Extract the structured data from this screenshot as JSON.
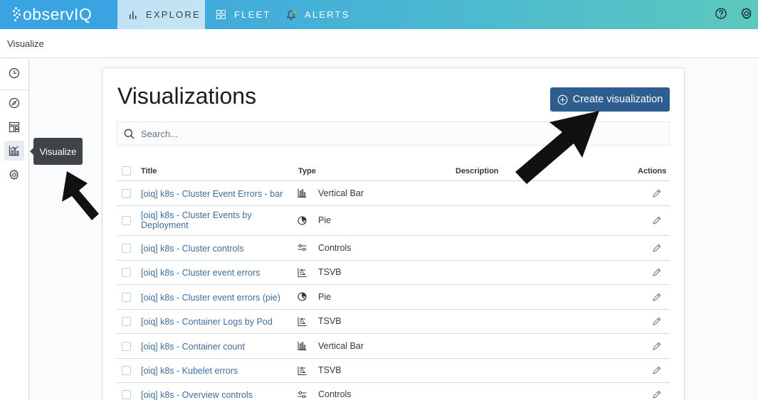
{
  "app": {
    "logo_text": "observIQ"
  },
  "topnav": {
    "tabs": [
      {
        "label": "EXPLORE",
        "icon": "bar-chart-icon",
        "active": true
      },
      {
        "label": "FLEET",
        "icon": "grid-icon",
        "active": false
      },
      {
        "label": "ALERTS",
        "icon": "bell-icon",
        "active": false
      }
    ],
    "right_icons": [
      "help-icon",
      "gear-icon"
    ]
  },
  "breadcrumb": {
    "current": "Visualize"
  },
  "sidenav": {
    "items": [
      "clock-icon",
      "compass-icon",
      "dashboard-icon",
      "visualize-icon",
      "gear-icon"
    ],
    "active": "visualize-icon",
    "tooltip": "Visualize"
  },
  "page": {
    "title": "Visualizations",
    "create_button": "Create visualization",
    "search_placeholder": "Search..."
  },
  "table": {
    "columns": {
      "title": "Title",
      "type": "Type",
      "description": "Description",
      "actions": "Actions"
    },
    "rows": [
      {
        "title": "[oiq] k8s - Cluster Event Errors - bar",
        "type": "Vertical Bar",
        "type_icon": "vertical-bar-icon"
      },
      {
        "title": "[oiq] k8s - Cluster Events by Deployment",
        "type": "Pie",
        "type_icon": "pie-icon"
      },
      {
        "title": "[oiq] k8s - Cluster controls",
        "type": "Controls",
        "type_icon": "controls-icon"
      },
      {
        "title": "[oiq] k8s - Cluster event errors",
        "type": "TSVB",
        "type_icon": "tsvb-icon"
      },
      {
        "title": "[oiq] k8s - Cluster event errors (pie)",
        "type": "Pie",
        "type_icon": "pie-icon"
      },
      {
        "title": "[oiq] k8s - Container Logs by Pod",
        "type": "TSVB",
        "type_icon": "tsvb-icon"
      },
      {
        "title": "[oiq] k8s - Container count",
        "type": "Vertical Bar",
        "type_icon": "vertical-bar-icon"
      },
      {
        "title": "[oiq] k8s - Kubelet errors",
        "type": "TSVB",
        "type_icon": "tsvb-icon"
      },
      {
        "title": "[oiq] k8s - Overview controls",
        "type": "Controls",
        "type_icon": "controls-icon"
      }
    ]
  },
  "colors": {
    "accent": "#2e5d8f",
    "link": "#3c6e9f",
    "nav_gradient_start": "#3a9ee0",
    "nav_gradient_end": "#5cc8bd"
  }
}
